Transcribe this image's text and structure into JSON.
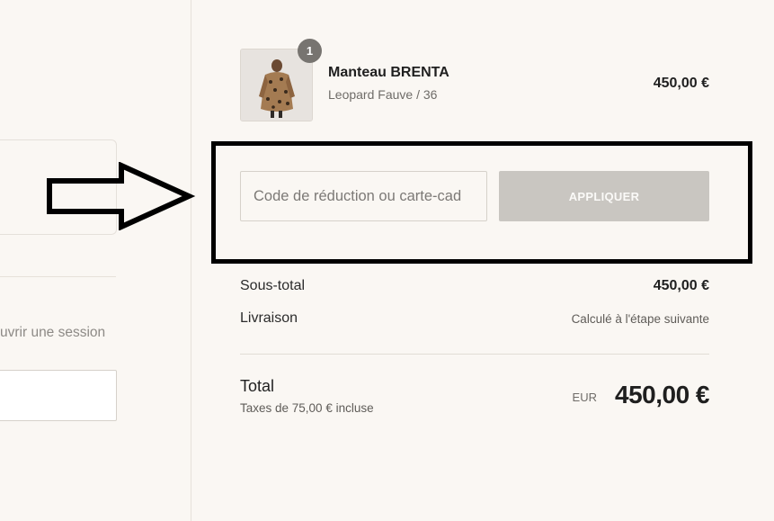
{
  "left": {
    "login_link": "uvrir une session"
  },
  "product": {
    "quantity_badge": "1",
    "name": "Manteau BRENTA",
    "variant": "Leopard Fauve / 36",
    "price": "450,00 €"
  },
  "discount": {
    "placeholder": "Code de réduction ou carte-cad",
    "apply_label": "APPLIQUER"
  },
  "summary": {
    "subtotal_label": "Sous-total",
    "subtotal_value": "450,00 €",
    "shipping_label": "Livraison",
    "shipping_value": "Calculé à l'étape suivante",
    "total_label": "Total",
    "taxes_note": "Taxes de 75,00 € incluse",
    "currency": "EUR",
    "total_value": "450,00 €"
  },
  "colors": {
    "background": "#faf7f3",
    "apply_button": "#c9c6c1",
    "annotation": "#000000",
    "badge": "#777470"
  },
  "icons": {
    "annotation_arrow": "arrow-right-icon"
  }
}
